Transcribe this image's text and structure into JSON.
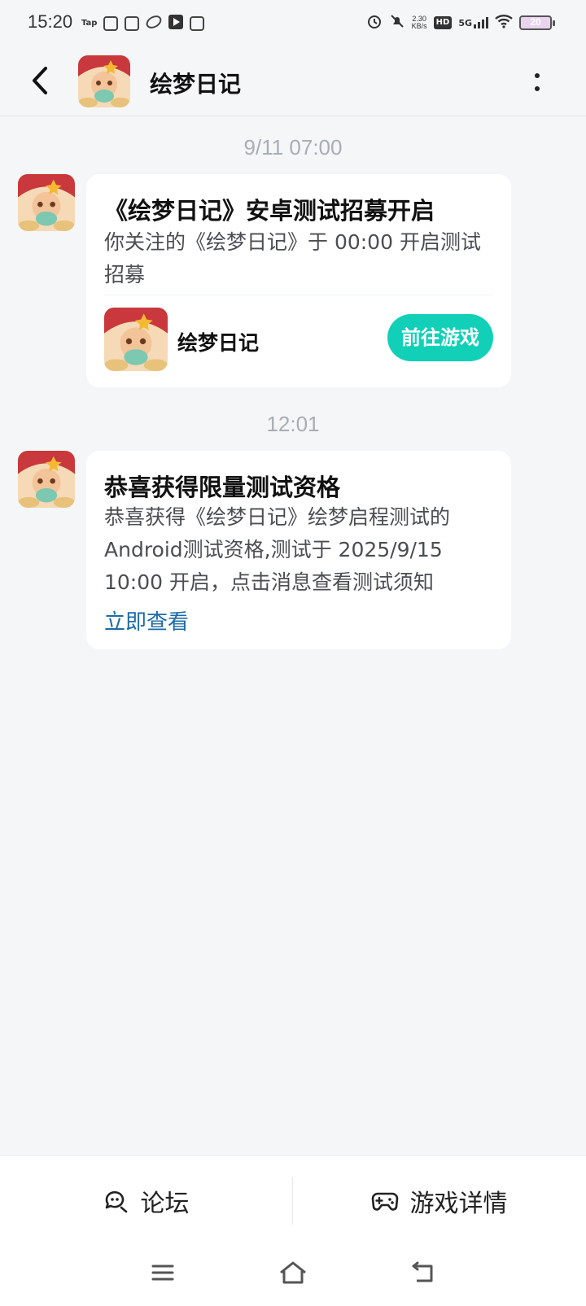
{
  "status_bar": {
    "time": "15:20",
    "left_icons": [
      "tap-icon",
      "grid-app-icon",
      "inbox-icon",
      "leaf-icon",
      "play-icon",
      "vivo-icon"
    ],
    "tap_label": "Tap",
    "net_speed_value": "2.30",
    "net_speed_unit": "KB/s",
    "hd_label": "HD",
    "network_label": "5G",
    "battery_level": "20"
  },
  "header": {
    "title": "绘梦日记",
    "back_icon": "chevron-left-icon",
    "more_icon": "more-vertical-icon"
  },
  "messages": [
    {
      "time": "9/11  07:00",
      "title": "《绘梦日记》安卓测试招募开启",
      "body": "你关注的《绘梦日记》于 00:00 开启测试招募",
      "game_name": "绘梦日记",
      "action_label": "前往游戏"
    },
    {
      "time": "12:01",
      "title": "恭喜获得限量测试资格",
      "body": "恭喜获得《绘梦日记》绘梦启程测试的Android测试资格,测试于 2025/9/15 10:00 开启，点击消息查看测试须知",
      "link_label": "立即查看"
    }
  ],
  "tabbar": {
    "forum_label": "论坛",
    "forum_icon": "forum-chat-icon",
    "details_label": "游戏详情",
    "details_icon": "gamepad-icon"
  },
  "colors": {
    "background": "#f4f6f8",
    "accent": "#12d0b8",
    "link": "#1d6aa6"
  }
}
